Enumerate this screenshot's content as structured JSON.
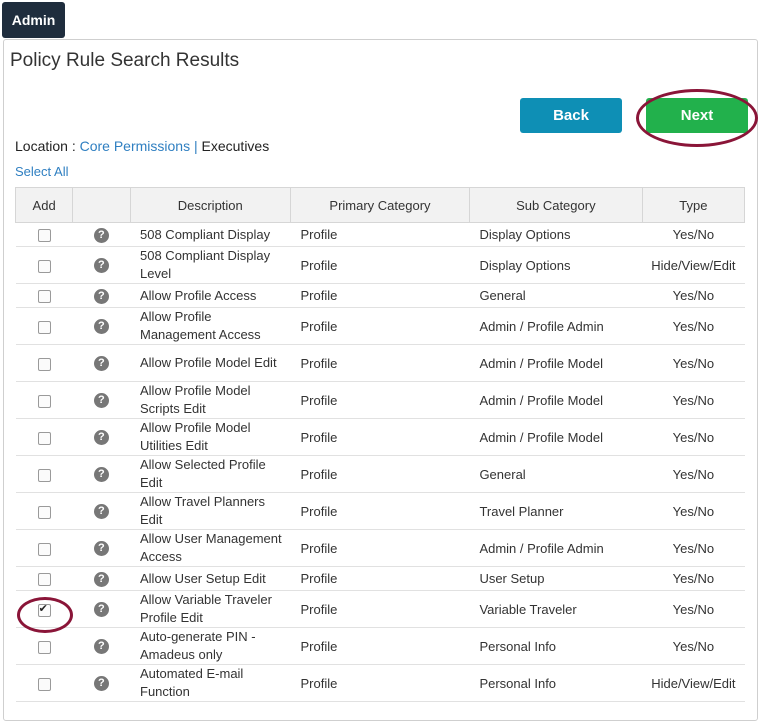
{
  "header": {
    "tab_label": "Admin"
  },
  "page": {
    "title": "Policy Rule Search Results"
  },
  "buttons": {
    "back_label": "Back",
    "next_label": "Next"
  },
  "location": {
    "prefix": "Location : ",
    "link": "Core Permissions",
    "separator": " | ",
    "current": "Executives"
  },
  "select_all": "Select All",
  "table": {
    "columns": [
      "Add",
      "",
      "Description",
      "Primary Category",
      "Sub Category",
      "Type"
    ],
    "rows": [
      {
        "checked": false,
        "desc": "508 Compliant Display",
        "primary": "Profile",
        "sub": "Display Options",
        "type": "Yes/No"
      },
      {
        "checked": false,
        "desc": "508 Compliant Display Level",
        "primary": "Profile",
        "sub": "Display Options",
        "type": "Hide/View/Edit"
      },
      {
        "checked": false,
        "desc": "Allow Profile Access",
        "primary": "Profile",
        "sub": "General",
        "type": "Yes/No"
      },
      {
        "checked": false,
        "desc": "Allow Profile Management Access",
        "primary": "Profile",
        "sub": "Admin / Profile Admin",
        "type": "Yes/No"
      },
      {
        "checked": false,
        "desc": "Allow Profile Model Edit",
        "primary": "Profile",
        "sub": "Admin / Profile Model",
        "type": "Yes/No"
      },
      {
        "checked": false,
        "desc": "Allow Profile Model Scripts Edit",
        "primary": "Profile",
        "sub": "Admin / Profile Model",
        "type": "Yes/No"
      },
      {
        "checked": false,
        "desc": "Allow Profile Model Utilities Edit",
        "primary": "Profile",
        "sub": "Admin / Profile Model",
        "type": "Yes/No"
      },
      {
        "checked": false,
        "desc": "Allow Selected Profile Edit",
        "primary": "Profile",
        "sub": "General",
        "type": "Yes/No"
      },
      {
        "checked": false,
        "desc": "Allow Travel Planners Edit",
        "primary": "Profile",
        "sub": "Travel Planner",
        "type": "Yes/No"
      },
      {
        "checked": false,
        "desc": "Allow User Management Access",
        "primary": "Profile",
        "sub": "Admin / Profile Admin",
        "type": "Yes/No"
      },
      {
        "checked": false,
        "desc": "Allow User Setup Edit",
        "primary": "Profile",
        "sub": "User Setup",
        "type": "Yes/No"
      },
      {
        "checked": true,
        "desc": "Allow Variable Traveler Profile Edit",
        "primary": "Profile",
        "sub": "Variable Traveler",
        "type": "Yes/No"
      },
      {
        "checked": false,
        "desc": "Auto-generate PIN - Amadeus only",
        "primary": "Profile",
        "sub": "Personal Info",
        "type": "Yes/No"
      },
      {
        "checked": false,
        "desc": "Automated E-mail Function",
        "primary": "Profile",
        "sub": "Personal Info",
        "type": "Hide/View/Edit"
      }
    ]
  },
  "help_icon_glyph": "?",
  "colors": {
    "back": "#0e8fb5",
    "next": "#22b14c",
    "highlight": "#8a1538",
    "link": "#2f7fc1",
    "admin_tab": "#1f2d3d"
  }
}
